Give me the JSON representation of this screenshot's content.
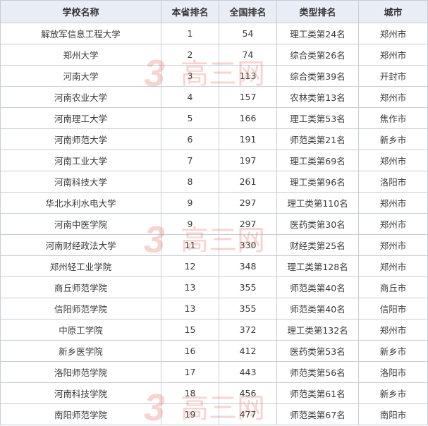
{
  "table": {
    "headers": [
      "学校名称",
      "本省排名",
      "全国排名",
      "类型排名",
      "城市"
    ],
    "rows": [
      [
        "解放军信息工程大学",
        "1",
        "54",
        "理工类第24名",
        "郑州市"
      ],
      [
        "郑州大学",
        "2",
        "74",
        "综合类第26名",
        "郑州市"
      ],
      [
        "河南大学",
        "3",
        "113",
        "综合类第39名",
        "开封市"
      ],
      [
        "河南农业大学",
        "4",
        "157",
        "农林类第13名",
        "郑州市"
      ],
      [
        "河南理工大学",
        "5",
        "166",
        "理工类第53名",
        "焦作市"
      ],
      [
        "河南师范大学",
        "6",
        "191",
        "师范类第21名",
        "新乡市"
      ],
      [
        "河南工业大学",
        "7",
        "197",
        "理工类第69名",
        "郑州市"
      ],
      [
        "河南科技大学",
        "8",
        "261",
        "理工类第96名",
        "洛阳市"
      ],
      [
        "华北水利水电大学",
        "9",
        "297",
        "理工类第110名",
        "郑州市"
      ],
      [
        "河南中医学院",
        "9",
        "297",
        "医药类第30名",
        "郑州市"
      ],
      [
        "河南财经政法大学",
        "11",
        "330",
        "财经类第25名",
        "郑州市"
      ],
      [
        "郑州轻工业学院",
        "12",
        "348",
        "理工类第128名",
        "郑州市"
      ],
      [
        "商丘师范学院",
        "13",
        "355",
        "师范类第40名",
        "商丘市"
      ],
      [
        "信阳师范学院",
        "13",
        "355",
        "师范类第40名",
        "信阳市"
      ],
      [
        "中原工学院",
        "15",
        "372",
        "理工类第132名",
        "郑州市"
      ],
      [
        "新乡医学院",
        "16",
        "412",
        "医药类第53名",
        "新乡市"
      ],
      [
        "洛阳师范学院",
        "17",
        "443",
        "师范类第56名",
        "洛阳市"
      ],
      [
        "河南科技学院",
        "18",
        "456",
        "师范类第61名",
        "新乡市"
      ],
      [
        "南阳师范学院",
        "19",
        "477",
        "师范类第67名",
        "南阳市"
      ]
    ]
  },
  "watermark": {
    "text": "高三网",
    "mark": "3",
    "color": "#e06a5c"
  }
}
